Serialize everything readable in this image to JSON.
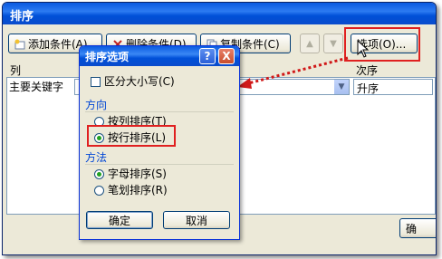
{
  "window": {
    "title": "排序"
  },
  "toolbar": {
    "add_label": "添加条件(A)",
    "delete_label": "删除条件(D)",
    "copy_label": "复制条件(C)",
    "up_arrow": "▲",
    "down_arrow": "▼",
    "options_label": "选项(O)..."
  },
  "columns": {
    "col": "列",
    "order": "次序"
  },
  "row": {
    "key_label": "主要关键字",
    "order_value": "升序"
  },
  "bottom": {
    "ok_partial": "确"
  },
  "dialog": {
    "title": "排序选项",
    "help": "?",
    "close": "X",
    "case_sensitive": "区分大小写(C)",
    "direction_group": "方向",
    "by_column": "按列排序(T)",
    "by_row": "按行排序(L)",
    "method_group": "方法",
    "alpha": "字母排序(S)",
    "stroke": "笔划排序(R)",
    "ok": "确定",
    "cancel": "取消",
    "selected_direction": "by_row",
    "selected_method": "alpha"
  },
  "colors": {
    "highlight": "#e02020",
    "arrow": "#d01818"
  }
}
